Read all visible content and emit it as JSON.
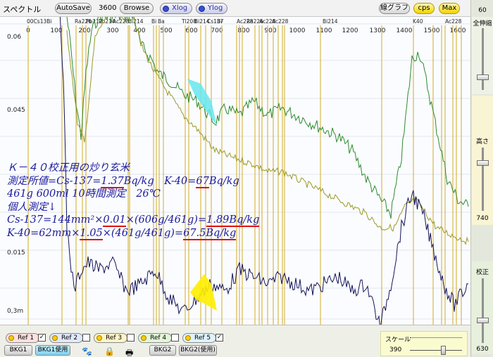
{
  "toolbar": {
    "title": "スペクトル",
    "autosave": "AutoSave",
    "count": "3600",
    "browse": "Browse",
    "xlog": "Xlog",
    "ylog": "Ylog",
    "graph_mode": "線グラフ",
    "cps": "cps",
    "max": "Max"
  },
  "side": {
    "top_value": "60",
    "zoom_label": "全伸縮",
    "height_label": "高さ",
    "height_value": "740",
    "calib_label": "校正",
    "calib_value": "630"
  },
  "chart_data": {
    "type": "line",
    "x_ticks": [
      "0",
      "100",
      "200",
      "300",
      "400",
      "500",
      "600",
      "700",
      "800",
      "900",
      "1000",
      "1100",
      "1200",
      "1300",
      "1400",
      "1500",
      "1600"
    ],
    "y_ticks": [
      "0.06",
      "0.045",
      "0.015",
      "0,3m"
    ],
    "nuclide_labels": [
      "00Cs13Bi",
      "Ra226",
      "Pb212",
      "Pb214",
      "Ac228",
      "Bi214",
      "Bi",
      "Ba",
      "Tl208",
      "Bi214",
      "Cs137",
      "Bi",
      "Ac228",
      "Ra226",
      "Ac228",
      "Ac228",
      "Bi214",
      "K40",
      "Ac228"
    ],
    "series": [
      {
        "color": "#2e8b2e",
        "values": []
      },
      {
        "color": "#9a9a28",
        "values": []
      },
      {
        "color": "#14145a",
        "values": []
      }
    ]
  },
  "annotation": {
    "line1": "Ｋ－４０校正用の炒り玄米",
    "line2_a": "測定所値=Cs-137=",
    "line2_b": "1.37",
    "line2_c": "Bq/kg　K-40=",
    "line2_d": "67",
    "line2_e": "Bq/kg",
    "line3": "461g 600ml 10時間測定　26℃",
    "line4": "個人測定↓",
    "line5_a": "Cs-137=144mm²×",
    "line5_b": "0.01",
    "line5_c": "×(606g/461g)=",
    "line5_d": "1.89Bq/kg",
    "line6_a": "K-40=62mm×",
    "line6_b": "1.05",
    "line6_c": "×(461g/461g)=",
    "line6_d": "67.5Bq/kg"
  },
  "bottom": {
    "refs": [
      "Ref 1",
      "Ref 2",
      "Ref 3",
      "Ref 4",
      "Ref 5"
    ],
    "bkg1": "BKG1",
    "bkg1_use": "BKG1使用",
    "bkg2": "BKG2",
    "bkg2_use": "BKG2(使用)",
    "scale_label": "スケール",
    "scale_value": "390"
  }
}
